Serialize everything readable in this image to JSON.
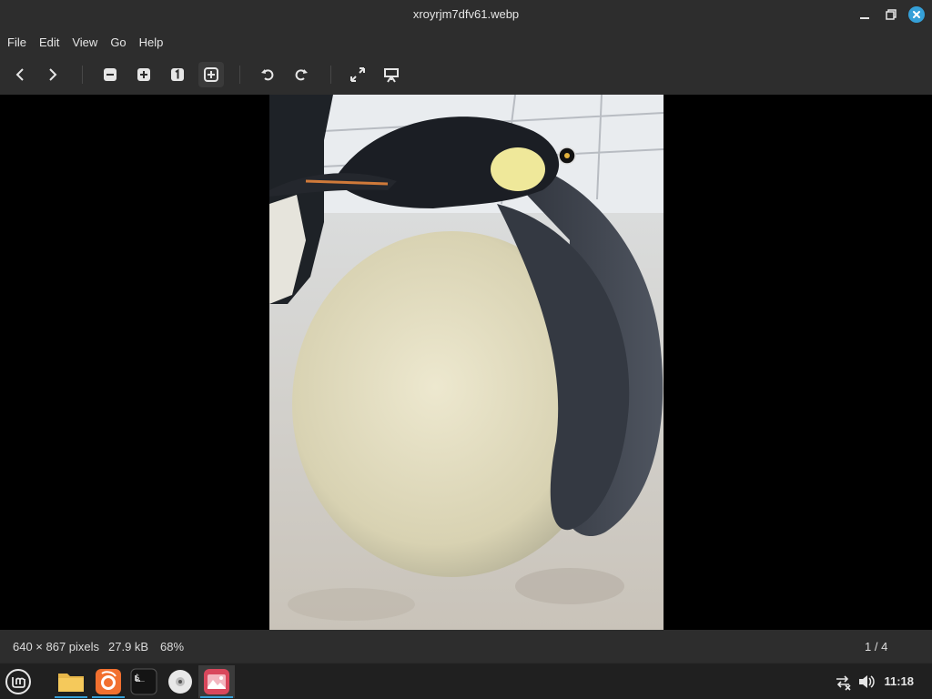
{
  "window": {
    "title": "xroyrjm7dfv61.webp"
  },
  "menu": {
    "items": [
      "File",
      "Edit",
      "View",
      "Go",
      "Help"
    ]
  },
  "toolbar": {
    "buttons": [
      {
        "name": "previous-image-button",
        "icon": "chevron-left-icon"
      },
      {
        "name": "next-image-button",
        "icon": "chevron-right-icon"
      },
      {
        "name": "zoom-out-button",
        "icon": "minus-square-icon"
      },
      {
        "name": "zoom-in-button",
        "icon": "plus-square-icon"
      },
      {
        "name": "zoom-1-1-button",
        "icon": "one-square-icon",
        "label": "1"
      },
      {
        "name": "zoom-fit-button",
        "icon": "fit-square-icon"
      },
      {
        "name": "rotate-left-button",
        "icon": "rotate-ccw-icon"
      },
      {
        "name": "rotate-right-button",
        "icon": "rotate-cw-icon"
      },
      {
        "name": "fullscreen-button",
        "icon": "expand-icon"
      },
      {
        "name": "slideshow-button",
        "icon": "easel-icon"
      }
    ]
  },
  "status": {
    "dimensions": "640 × 867 pixels",
    "size": "27.9 kB",
    "zoom": "68%",
    "position": "1 / 4"
  },
  "taskbar": {
    "apps": [
      {
        "name": "menu",
        "icon": "mint-logo-icon"
      },
      {
        "name": "files",
        "icon": "folder-icon"
      },
      {
        "name": "firefox",
        "icon": "firefox-icon"
      },
      {
        "name": "terminal",
        "icon": "terminal-icon",
        "label": "$_"
      },
      {
        "name": "disc",
        "icon": "disc-icon"
      },
      {
        "name": "image-viewer",
        "icon": "image-viewer-icon"
      }
    ],
    "clock": "11:18"
  },
  "colors": {
    "bar": "#2d2d2d",
    "accent": "#35a0d8",
    "taskbar": "#202020"
  }
}
